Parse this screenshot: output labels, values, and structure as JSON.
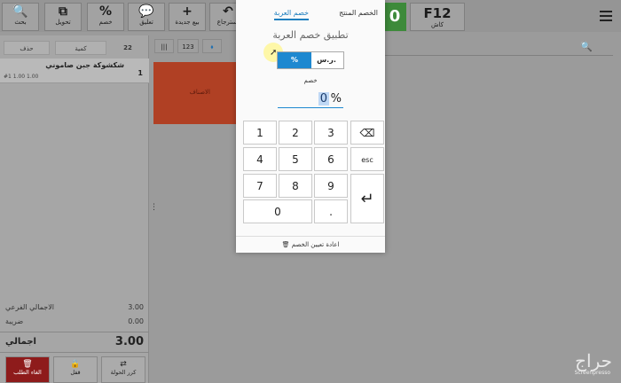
{
  "toolbar": {
    "items": [
      {
        "label": "بحث",
        "icon": "🔍"
      },
      {
        "label": "تحويل",
        "icon": "⧉"
      },
      {
        "label": "خصم",
        "icon": "%"
      },
      {
        "label": "تعليق",
        "icon": "💬"
      },
      {
        "label": "بيع جديدة",
        "icon": "+"
      },
      {
        "label": "استرجاع",
        "icon": "↶"
      }
    ],
    "green_button": "0",
    "cashier_key": "F12",
    "cashier_label": "كاش"
  },
  "left_pane": {
    "header": {
      "count": "22",
      "qty_label": "كمية",
      "delete_label": "حذف"
    },
    "item": {
      "name": "شكشوكة جبن صاموني",
      "qty": "1",
      "sub_left": "#1  1.00  1.00"
    },
    "subtotal_label": "الاجمالي الفرعي",
    "subtotal_value": "3.00",
    "tax_label": "ضريبة",
    "tax_value": "0.00",
    "grand_label": "اجمالي",
    "grand_value": "3.00",
    "bottom_buttons": [
      {
        "label": "الغاء الطلب",
        "icon": "🗑"
      },
      {
        "label": "قفل",
        "icon": "🔒"
      },
      {
        "label": "كرر الحولة",
        "icon": "⇄"
      }
    ]
  },
  "main": {
    "toolbar_items": [
      "|||",
      "123",
      "⬧"
    ],
    "tile_label": "الاصناف"
  },
  "modal": {
    "tabs": [
      "الخصم المنتج",
      "خصم العربة"
    ],
    "title": "تطبيق خصم العربة",
    "segments": [
      "ر.س.",
      "%"
    ],
    "discount_label": "خصم",
    "discount_value": "0",
    "discount_unit": "%",
    "keys": [
      "1",
      "2",
      "3",
      "⌫",
      "4",
      "5",
      "6",
      "esc",
      "7",
      "8",
      "9",
      "↵",
      "0",
      "."
    ],
    "reset_label": "اعادة تعيين الخصم"
  },
  "watermark": {
    "text": "حراج",
    "sub": "Screenpresso"
  }
}
